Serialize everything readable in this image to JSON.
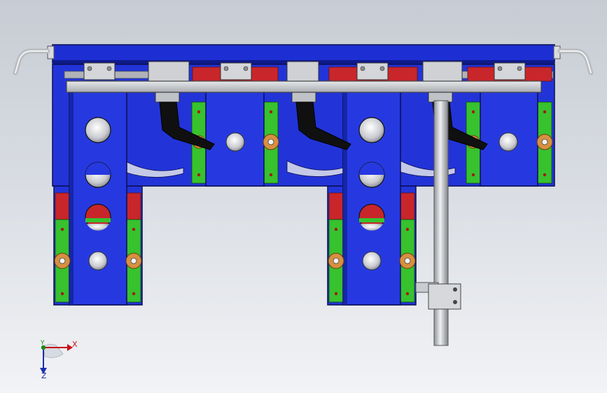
{
  "viewport": {
    "background_top": "#c7ccd4",
    "background_bottom": "#f2f3f6"
  },
  "colors": {
    "frame_blue": "#1d2fd3",
    "frame_blue_dark": "#0f1a8a",
    "rail_gray": "#c9ccd0",
    "accent_red": "#c8262a",
    "accent_green": "#37c22e",
    "bolt_orange": "#d6903f",
    "steel_light": "#e8eaed",
    "clamp_black": "#101010"
  },
  "triad": {
    "x_label": "X",
    "y_label": "Y",
    "z_label": "Z",
    "x_color": "#c8101a",
    "y_color": "#1b8a1b",
    "z_color": "#1b2fb0"
  }
}
